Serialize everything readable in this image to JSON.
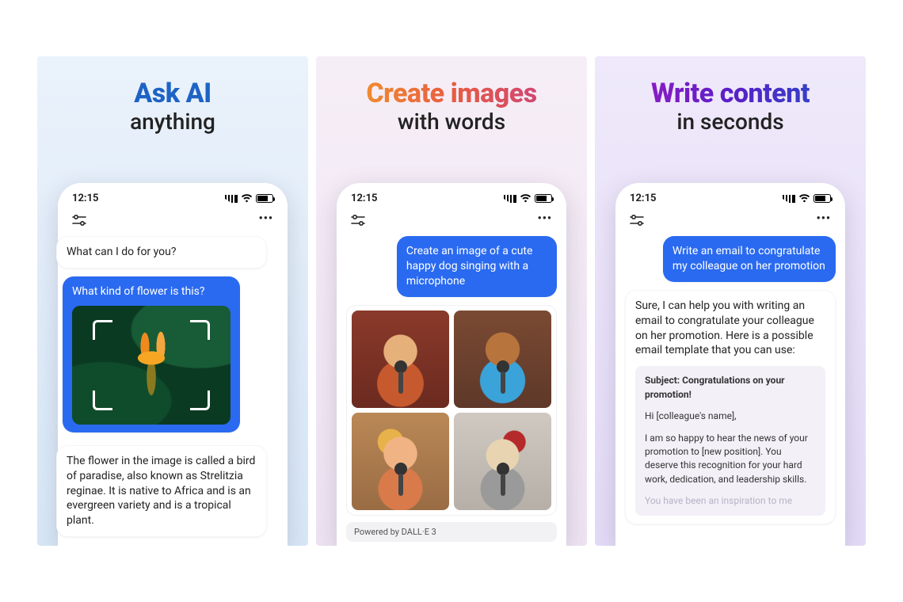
{
  "panels": [
    {
      "headline_main": "Ask AI",
      "headline_sub": "anything",
      "status_time": "12:15",
      "bot_greeting": "What can I do for you?",
      "user_question": "What kind of flower is this?",
      "bot_answer": "The flower in the image is called a bird of paradise, also known as Strelitzia reginae. It is native to Africa and is an evergreen variety and is a tropical plant."
    },
    {
      "headline_main": "Create images",
      "headline_sub": "with words",
      "status_time": "12:15",
      "user_prompt": "Create an image of a cute happy dog singing with a microphone",
      "powered_by": "Powered by DALL·E 3"
    },
    {
      "headline_main": "Write content",
      "headline_sub": "in seconds",
      "status_time": "12:15",
      "user_prompt": "Write an email to congratulate my colleague on her promotion",
      "bot_intro": "Sure, I can help you with writing an email to congratulate your colleague on her promotion. Here is a possible email template that you can use:",
      "email_subject": "Subject: Congratulations on your promotion!",
      "email_greeting": "Hi [colleague's name],",
      "email_body": "I am so happy to hear the news of your promotion to [new position]. You deserve this recognition for your hard work, dedication, and leadership skills.",
      "email_fade": "You have been an inspiration to me"
    }
  ],
  "icons": {
    "more": "•••"
  }
}
